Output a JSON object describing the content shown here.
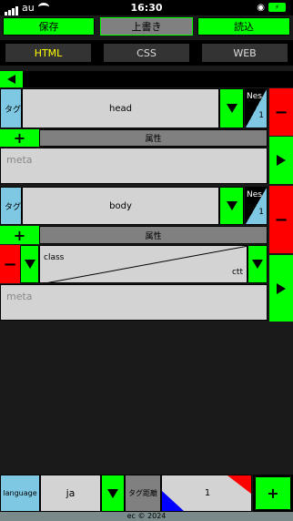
{
  "status": {
    "carrier": "au",
    "time": "16:30"
  },
  "toolbar": {
    "save": "保存",
    "overwrite": "上書き",
    "load": "読込"
  },
  "tabs": [
    {
      "label": "HTML"
    },
    {
      "label": "CSS"
    },
    {
      "label": "WEB"
    }
  ],
  "back": {
    "icon": "left-triangle-icon"
  },
  "head_block": {
    "tag_label": "タグ",
    "tag_value": "head",
    "nest_label": "Nes",
    "nest_value": "1",
    "attr_header": "属性",
    "content_placeholder": "meta"
  },
  "body_block": {
    "tag_label": "タグ",
    "tag_value": "body",
    "nest_label": "Nes",
    "nest_value": "1",
    "attr_header": "属性",
    "attr_name": "class",
    "attr_value": "ctt",
    "content_placeholder": "meta"
  },
  "bottom": {
    "language_label": "language",
    "language_value": "ja",
    "distance_label": "タグ距離",
    "distance_value": "1"
  },
  "footer": {
    "copyright": "ec © 2024"
  },
  "colors": {
    "accent": "#00ff00",
    "danger": "#ff0000",
    "label": "#7ec8e3",
    "field": "#d3d3d3"
  }
}
